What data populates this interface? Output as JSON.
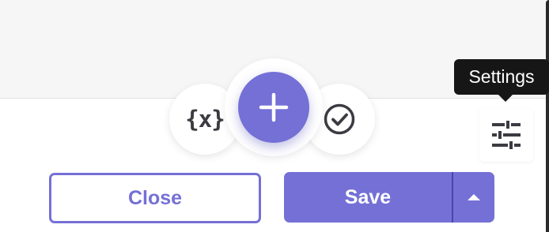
{
  "toolbar": {
    "variable_icon_text": "{x}",
    "settings_tooltip": "Settings"
  },
  "footer": {
    "close_label": "Close",
    "save_label": "Save"
  },
  "icons": {
    "variable": "variable-braces-icon",
    "add": "plus-icon",
    "check": "check-circle-icon",
    "settings": "sliders-icon",
    "save_menu": "caret-up-icon"
  },
  "colors": {
    "accent": "#7470d6",
    "tooltip_bg": "#161616",
    "icon_dark": "#3b3b42"
  }
}
